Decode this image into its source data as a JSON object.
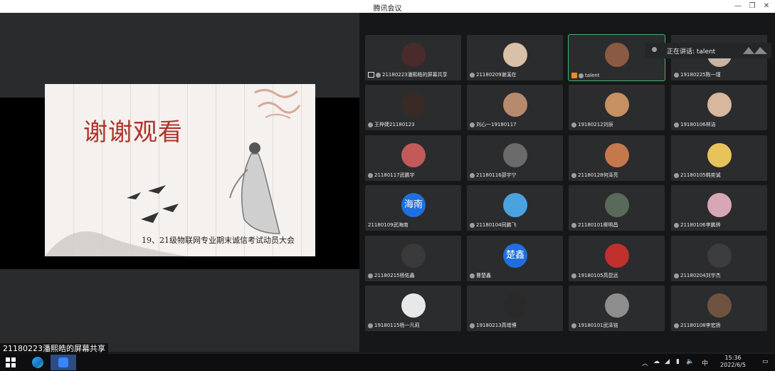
{
  "window": {
    "title": "腾讯会议",
    "minimize_glyph": "—",
    "restore_glyph": "❐",
    "close_glyph": "✕"
  },
  "slide": {
    "title": "谢谢观看",
    "subtitle": "19、21级物联网专业期末诚信考试动员大会"
  },
  "share_label": "21180223潘熙皓的屏幕共享",
  "speaking": {
    "label": "正在讲话: talent"
  },
  "participants": [
    {
      "name": "21180223潘熙皓的屏幕共享",
      "avatar": "photo",
      "color": "#4a2b2c",
      "icon": "share"
    },
    {
      "name": "21180209谢溪在",
      "avatar": "photo",
      "color": "#d9c0a8"
    },
    {
      "name": "talent",
      "avatar": "photo",
      "color": "#8a5a44",
      "icon": "host",
      "active": true
    },
    {
      "name": "19180225陈一瑾",
      "avatar": "photo",
      "color": "#c9b3a1"
    },
    {
      "name": "王梓婕21180123",
      "avatar": "photo",
      "color": "#3a2a25"
    },
    {
      "name": "刘心一19180117",
      "avatar": "photo",
      "color": "#b88a6d"
    },
    {
      "name": "19180212刘辰",
      "avatar": "photo",
      "color": "#c69062"
    },
    {
      "name": "19180106林洁",
      "avatar": "photo",
      "color": "#d9b79c"
    },
    {
      "name": "21180117武鹏宇",
      "avatar": "photo",
      "color": "#c25a5a"
    },
    {
      "name": "21180116邵宇宁",
      "avatar": "photo",
      "color": "#6b6b6b"
    },
    {
      "name": "21180128何泽亮",
      "avatar": "photo",
      "color": "#c4784c"
    },
    {
      "name": "21180105韩奕诚",
      "avatar": "photo",
      "color": "#e8c25a"
    },
    {
      "name": "21180109武海南",
      "avatar": "text",
      "text": "海南",
      "color": "#1f6fe0"
    },
    {
      "name": "21180104同鹏飞",
      "avatar": "photo",
      "color": "#4aa3df"
    },
    {
      "name": "21180101柳明昌",
      "avatar": "photo",
      "color": "#5a6a5a"
    },
    {
      "name": "21180106李鹏骅",
      "avatar": "photo",
      "color": "#d8a7b5"
    },
    {
      "name": "21180215杨佑鑫",
      "avatar": "photo",
      "color": "#3a3a3a"
    },
    {
      "name": "曹楚鑫",
      "avatar": "text",
      "text": "楚鑫",
      "color": "#1f6fe0"
    },
    {
      "name": "19180105高昆远",
      "avatar": "photo",
      "color": "#c0302c"
    },
    {
      "name": "21180204刘宇杰",
      "avatar": "photo",
      "color": "#3d3d3d"
    },
    {
      "name": "19180115杨一凡莉",
      "avatar": "photo",
      "color": "#e8e8e8"
    },
    {
      "name": "19180213高增博",
      "avatar": "photo",
      "color": "#2a2a2a"
    },
    {
      "name": "19180101武泽铭",
      "avatar": "photo",
      "color": "#8e8e8e"
    },
    {
      "name": "21180108李宏扬",
      "avatar": "photo",
      "color": "#6e5440"
    }
  ],
  "taskbar": {
    "ime": "中",
    "time": "15:36",
    "date": "2022/6/5"
  },
  "colors": {
    "active_border": "#3fb36b",
    "slide_title": "#b0322c",
    "text_avatar": "#1f6fe0"
  }
}
